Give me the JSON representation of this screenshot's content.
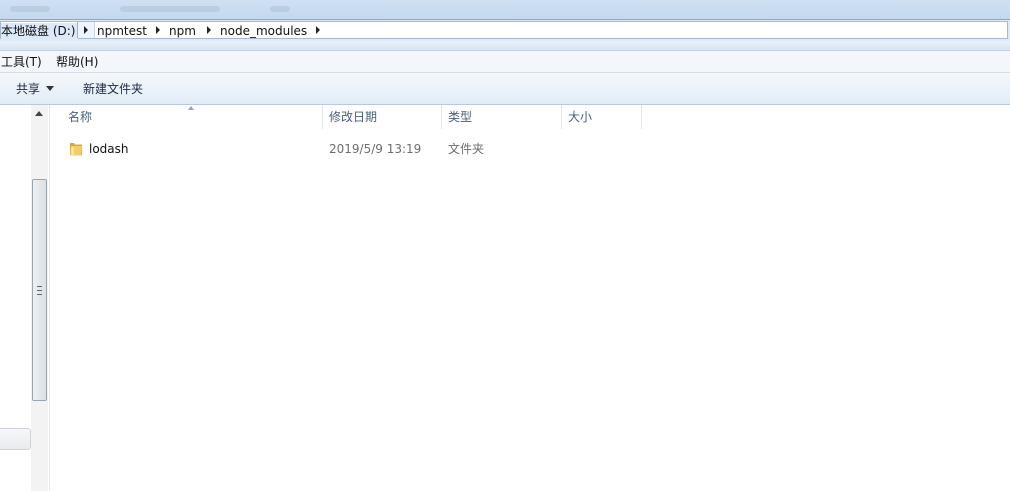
{
  "address_bar": {
    "drive": "本地磁盘 (D:)",
    "crumbs": [
      "npmtest",
      "npm",
      "node_modules"
    ]
  },
  "menu": {
    "items": [
      "工具(T)",
      "帮助(H)"
    ]
  },
  "toolbar": {
    "share_label": "共享",
    "new_folder_label": "新建文件夹"
  },
  "file_list": {
    "columns": [
      "名称",
      "修改日期",
      "类型",
      "大小"
    ],
    "rows": [
      {
        "name": "lodash",
        "modified": "2019/5/9 13:19",
        "type": "文件夹",
        "size": ""
      }
    ]
  },
  "colors": {
    "folder": "#e8c25a",
    "header_text": "#4c607a"
  }
}
